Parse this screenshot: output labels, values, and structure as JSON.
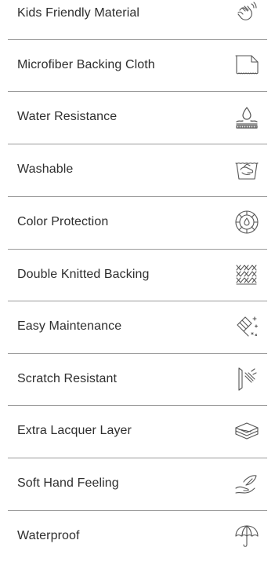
{
  "features": [
    {
      "label": "Kids Friendly Material",
      "icon": "child-hand-icon"
    },
    {
      "label": "Microfiber Backing Cloth",
      "icon": "cloth-icon"
    },
    {
      "label": "Water Resistance",
      "icon": "water-drop-icon"
    },
    {
      "label": "Washable",
      "icon": "hand-wash-icon"
    },
    {
      "label": "Color Protection",
      "icon": "color-wheel-icon"
    },
    {
      "label": "Double Knitted Backing",
      "icon": "knit-pattern-icon"
    },
    {
      "label": "Easy Maintenance",
      "icon": "cleaning-sparkle-icon"
    },
    {
      "label": "Scratch Resistant",
      "icon": "scratch-shield-icon"
    },
    {
      "label": "Extra Lacquer Layer",
      "icon": "layers-icon"
    },
    {
      "label": "Soft Hand Feeling",
      "icon": "feather-hand-icon"
    },
    {
      "label": "Waterproof",
      "icon": "umbrella-icon"
    }
  ],
  "colors": {
    "text": "#2e2e2e",
    "divider": "#9a9a9a",
    "icon_stroke": "#555555"
  }
}
